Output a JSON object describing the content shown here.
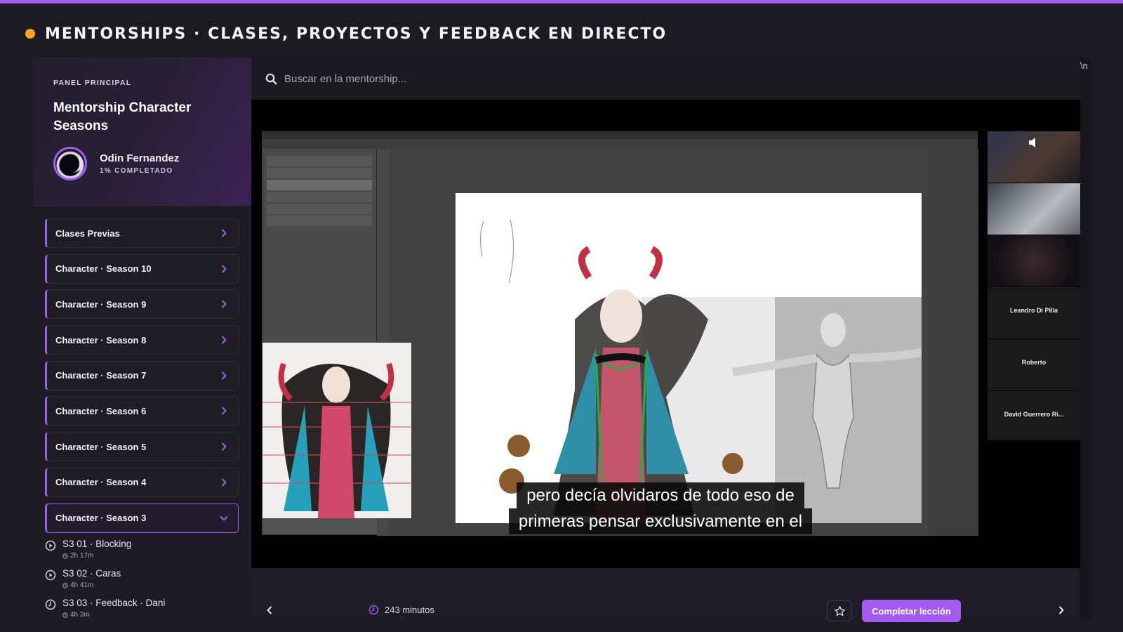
{
  "header": {
    "title": "MENTORSHIPS · CLASES, PROYECTOS Y FEEDBACK EN DIRECTO",
    "accent_color": "#a35bf2",
    "dot_color": "#f5a623"
  },
  "sidebar": {
    "eyebrow": "PANEL PRINCIPAL",
    "course_title": "Mentorship Character Seasons",
    "user": {
      "name": "Odin Fernandez",
      "progress": "1% COMPLETADO"
    },
    "items": [
      {
        "label": "Clases Previas"
      },
      {
        "label": "Character · Season 10"
      },
      {
        "label": "Character · Season 9"
      },
      {
        "label": "Character · Season 8"
      },
      {
        "label": "Character · Season 7"
      },
      {
        "label": "Character · Season 6"
      },
      {
        "label": "Character · Season 5"
      },
      {
        "label": "Character · Season 4"
      }
    ],
    "open_item": {
      "label": "Character · Season 3"
    },
    "lessons": [
      {
        "title": "S3 01 · Blocking",
        "duration": "2h 17m",
        "icon": "play-circle-icon"
      },
      {
        "title": "S3 02 · Caras",
        "duration": "4h 41m",
        "icon": "play-circle-icon"
      },
      {
        "title": "S3 03 · Feedback · Dani",
        "duration": "4h 3m",
        "icon": "clock-icon"
      }
    ]
  },
  "search": {
    "placeholder": "Buscar en la mentorship..."
  },
  "video": {
    "subtitle_line1": "pero decía olvidaros de todo eso de",
    "subtitle_line2": "primeras pensar exclusivamente en el",
    "participants": [
      {
        "name": "Leandro Di Pilla"
      },
      {
        "name": "Roberto"
      },
      {
        "name": "David Guerrero Ri..."
      }
    ]
  },
  "controls": {
    "duration": "243 minutos",
    "complete_label": "Completar lección"
  },
  "edge_text": "\\n"
}
